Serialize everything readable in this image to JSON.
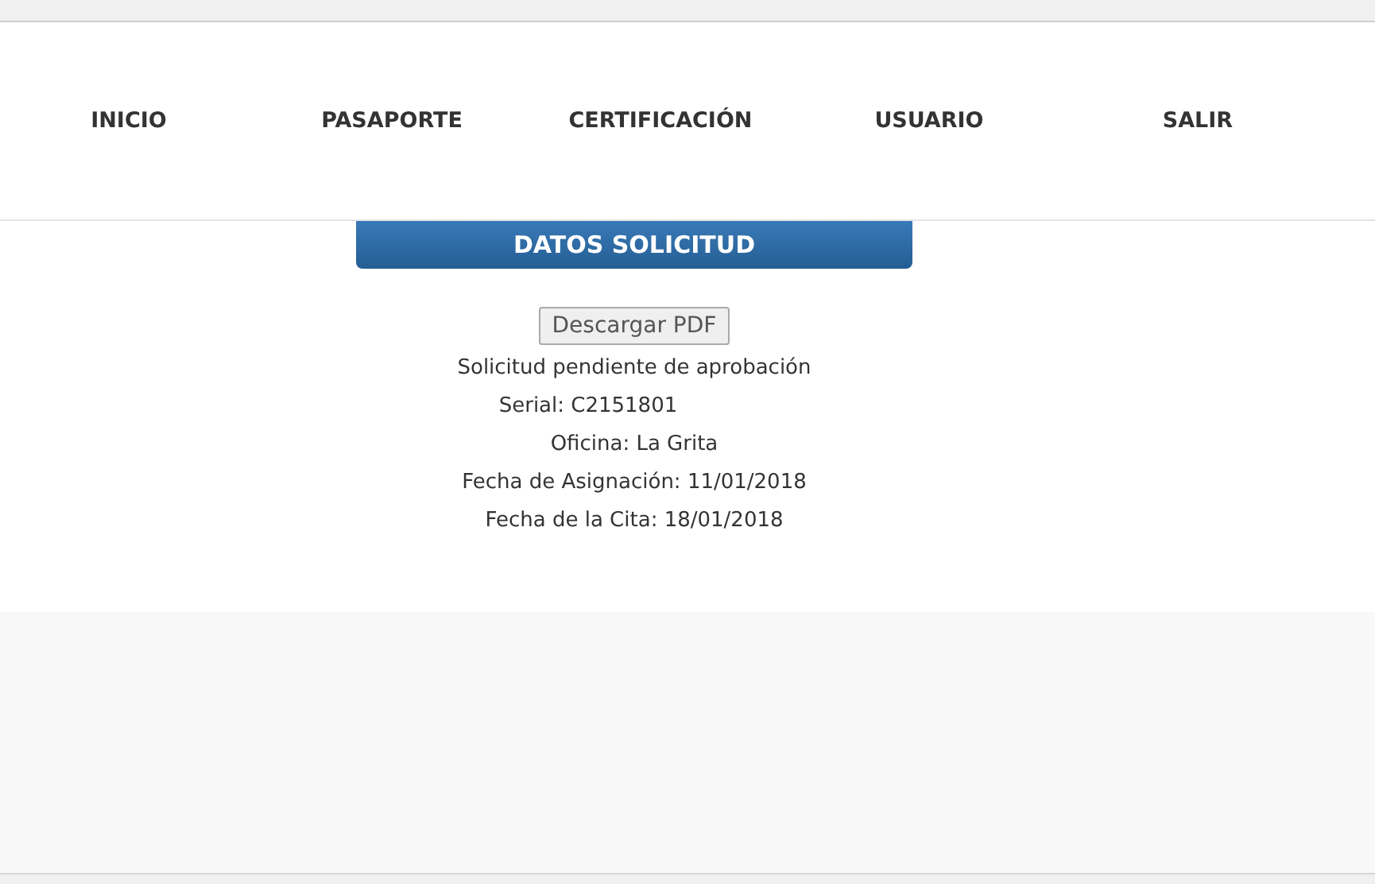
{
  "nav": {
    "items": [
      {
        "label": "INICIO"
      },
      {
        "label": "PASAPORTE"
      },
      {
        "label": "CERTIFICACIÓN"
      },
      {
        "label": "USUARIO"
      },
      {
        "label": "SALIR"
      }
    ]
  },
  "panel": {
    "title": "DATOS SOLICITUD",
    "download_button": "Descargar PDF",
    "status": "Solicitud pendiente de aprobación",
    "details": [
      {
        "kind": "serial",
        "text": "Serial: C2151801"
      },
      {
        "kind": "plain",
        "text": "Oficina: La Grita"
      },
      {
        "kind": "plain",
        "text": "Fecha de Asignación: 11/01/2018"
      },
      {
        "kind": "plain",
        "text": "Fecha de la Cita: 18/01/2018"
      }
    ]
  }
}
